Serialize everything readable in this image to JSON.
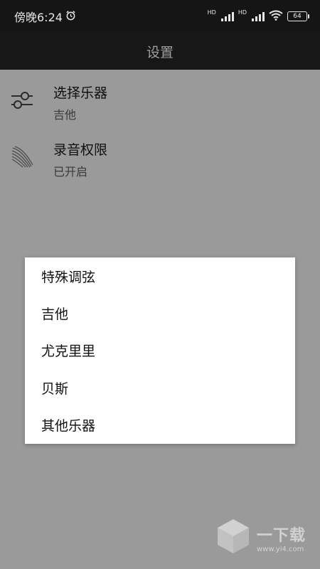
{
  "status_bar": {
    "time": "傍晚6:24",
    "hd1": "HD",
    "hd2": "HD",
    "battery": "64"
  },
  "app_bar": {
    "title": "设置"
  },
  "settings": [
    {
      "title": "选择乐器",
      "value": "吉他",
      "icon": "sliders-icon"
    },
    {
      "title": "录音权限",
      "value": "已开启",
      "icon": "sound-waves-icon"
    }
  ],
  "dialog": {
    "options": [
      "特殊调弦",
      "吉他",
      "尤克里里",
      "贝斯",
      "其他乐器"
    ]
  },
  "watermark": {
    "brand": "一下载",
    "url": "www.yi4.com"
  },
  "colors": {
    "status_bg": "#151515",
    "app_bar_bg": "#171717",
    "scrim_bg": "#9a9a9a",
    "dialog_bg": "#ffffff"
  }
}
